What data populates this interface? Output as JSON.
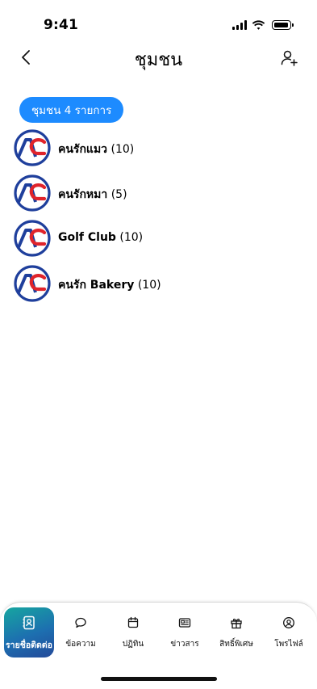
{
  "status_bar": {
    "time": "9:41"
  },
  "header": {
    "title": "ชุมชน"
  },
  "count_pill": {
    "label": "ชุมชน 4 รายการ"
  },
  "communities": [
    {
      "name": "คนรักแมว",
      "count": "(10)"
    },
    {
      "name": "คนรักหมา",
      "count": "(5)"
    },
    {
      "name": "Golf Club",
      "count": "(10)"
    },
    {
      "name": "คนรัก Bakery",
      "count": "(10)"
    }
  ],
  "tabs": [
    {
      "label": "รายชื่อติดต่อ",
      "icon": "contacts-icon",
      "active": true
    },
    {
      "label": "ข้อความ",
      "icon": "chat-bubble-icon"
    },
    {
      "label": "ปฏิทิน",
      "icon": "calendar-icon"
    },
    {
      "label": "ข่าวสาร",
      "icon": "newspaper-icon"
    },
    {
      "label": "สิทธิ์พิเศษ",
      "icon": "gift-icon"
    },
    {
      "label": "โพรไฟล์",
      "icon": "profile-icon"
    }
  ],
  "colors": {
    "accent": "#1d8bff",
    "logo_blue": "#1f3f9c",
    "logo_red": "#e0242b"
  }
}
